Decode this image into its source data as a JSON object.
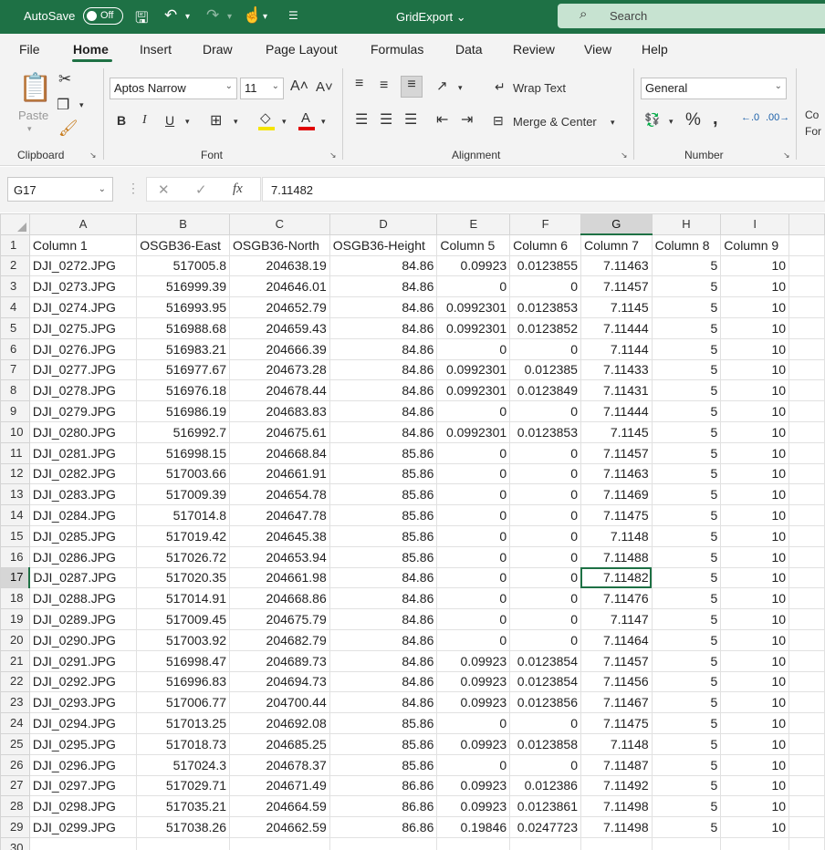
{
  "titlebar": {
    "autosave_label": "AutoSave",
    "autosave_state": "Off",
    "document_title": "GridExport",
    "search_placeholder": "Search"
  },
  "menu": {
    "tabs": [
      "File",
      "Home",
      "Insert",
      "Draw",
      "Page Layout",
      "Formulas",
      "Data",
      "Review",
      "View",
      "Help"
    ],
    "active_tab": "Home"
  },
  "ribbon": {
    "clipboard": {
      "label": "Clipboard",
      "paste_label": "Paste"
    },
    "font": {
      "label": "Font",
      "font_name": "Aptos Narrow",
      "font_size": "11"
    },
    "alignment": {
      "label": "Alignment",
      "wrap_text": "Wrap Text",
      "merge_center": "Merge & Center"
    },
    "number": {
      "label": "Number",
      "format": "General"
    },
    "cut_off_label": "Co\nFor"
  },
  "formula_bar": {
    "name_box": "G17",
    "formula": "7.11482"
  },
  "sheet": {
    "columns": [
      "A",
      "B",
      "C",
      "D",
      "E",
      "F",
      "G",
      "H",
      "I"
    ],
    "selected_column": "G",
    "selected_row": 17,
    "header_row": [
      "Column 1",
      "OSGB36-East",
      "OSGB36-North",
      "OSGB36-Height",
      "Column 5",
      "Column 6",
      "Column 7",
      "Column 8",
      "Column 9"
    ],
    "rows": [
      [
        "DJI_0272.JPG",
        "517005.8",
        "204638.19",
        "84.86",
        "0.09923",
        "0.0123855",
        "7.11463",
        "5",
        "10"
      ],
      [
        "DJI_0273.JPG",
        "516999.39",
        "204646.01",
        "84.86",
        "0",
        "0",
        "7.11457",
        "5",
        "10"
      ],
      [
        "DJI_0274.JPG",
        "516993.95",
        "204652.79",
        "84.86",
        "0.0992301",
        "0.0123853",
        "7.1145",
        "5",
        "10"
      ],
      [
        "DJI_0275.JPG",
        "516988.68",
        "204659.43",
        "84.86",
        "0.0992301",
        "0.0123852",
        "7.11444",
        "5",
        "10"
      ],
      [
        "DJI_0276.JPG",
        "516983.21",
        "204666.39",
        "84.86",
        "0",
        "0",
        "7.1144",
        "5",
        "10"
      ],
      [
        "DJI_0277.JPG",
        "516977.67",
        "204673.28",
        "84.86",
        "0.0992301",
        "0.012385",
        "7.11433",
        "5",
        "10"
      ],
      [
        "DJI_0278.JPG",
        "516976.18",
        "204678.44",
        "84.86",
        "0.0992301",
        "0.0123849",
        "7.11431",
        "5",
        "10"
      ],
      [
        "DJI_0279.JPG",
        "516986.19",
        "204683.83",
        "84.86",
        "0",
        "0",
        "7.11444",
        "5",
        "10"
      ],
      [
        "DJI_0280.JPG",
        "516992.7",
        "204675.61",
        "84.86",
        "0.0992301",
        "0.0123853",
        "7.1145",
        "5",
        "10"
      ],
      [
        "DJI_0281.JPG",
        "516998.15",
        "204668.84",
        "85.86",
        "0",
        "0",
        "7.11457",
        "5",
        "10"
      ],
      [
        "DJI_0282.JPG",
        "517003.66",
        "204661.91",
        "85.86",
        "0",
        "0",
        "7.11463",
        "5",
        "10"
      ],
      [
        "DJI_0283.JPG",
        "517009.39",
        "204654.78",
        "85.86",
        "0",
        "0",
        "7.11469",
        "5",
        "10"
      ],
      [
        "DJI_0284.JPG",
        "517014.8",
        "204647.78",
        "85.86",
        "0",
        "0",
        "7.11475",
        "5",
        "10"
      ],
      [
        "DJI_0285.JPG",
        "517019.42",
        "204645.38",
        "85.86",
        "0",
        "0",
        "7.1148",
        "5",
        "10"
      ],
      [
        "DJI_0286.JPG",
        "517026.72",
        "204653.94",
        "85.86",
        "0",
        "0",
        "7.11488",
        "5",
        "10"
      ],
      [
        "DJI_0287.JPG",
        "517020.35",
        "204661.98",
        "84.86",
        "0",
        "0",
        "7.11482",
        "5",
        "10"
      ],
      [
        "DJI_0288.JPG",
        "517014.91",
        "204668.86",
        "84.86",
        "0",
        "0",
        "7.11476",
        "5",
        "10"
      ],
      [
        "DJI_0289.JPG",
        "517009.45",
        "204675.79",
        "84.86",
        "0",
        "0",
        "7.1147",
        "5",
        "10"
      ],
      [
        "DJI_0290.JPG",
        "517003.92",
        "204682.79",
        "84.86",
        "0",
        "0",
        "7.11464",
        "5",
        "10"
      ],
      [
        "DJI_0291.JPG",
        "516998.47",
        "204689.73",
        "84.86",
        "0.09923",
        "0.0123854",
        "7.11457",
        "5",
        "10"
      ],
      [
        "DJI_0292.JPG",
        "516996.83",
        "204694.73",
        "84.86",
        "0.09923",
        "0.0123854",
        "7.11456",
        "5",
        "10"
      ],
      [
        "DJI_0293.JPG",
        "517006.77",
        "204700.44",
        "84.86",
        "0.09923",
        "0.0123856",
        "7.11467",
        "5",
        "10"
      ],
      [
        "DJI_0294.JPG",
        "517013.25",
        "204692.08",
        "85.86",
        "0",
        "0",
        "7.11475",
        "5",
        "10"
      ],
      [
        "DJI_0295.JPG",
        "517018.73",
        "204685.25",
        "85.86",
        "0.09923",
        "0.0123858",
        "7.1148",
        "5",
        "10"
      ],
      [
        "DJI_0296.JPG",
        "517024.3",
        "204678.37",
        "85.86",
        "0",
        "0",
        "7.11487",
        "5",
        "10"
      ],
      [
        "DJI_0297.JPG",
        "517029.71",
        "204671.49",
        "86.86",
        "0.09923",
        "0.012386",
        "7.11492",
        "5",
        "10"
      ],
      [
        "DJI_0298.JPG",
        "517035.21",
        "204664.59",
        "86.86",
        "0.09923",
        "0.0123861",
        "7.11498",
        "5",
        "10"
      ],
      [
        "DJI_0299.JPG",
        "517038.26",
        "204662.59",
        "86.86",
        "0.19846",
        "0.0247723",
        "7.11498",
        "5",
        "10"
      ]
    ],
    "empty_row_number": "30",
    "accent_color": "#1e7145"
  }
}
